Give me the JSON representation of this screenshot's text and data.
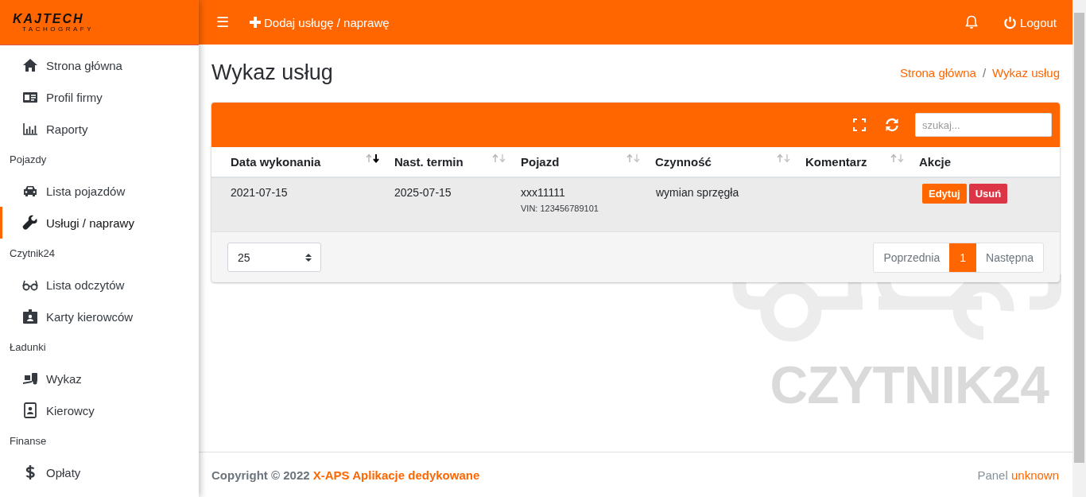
{
  "logo": {
    "name": "KAJTECH",
    "subtitle": "TACHOGRAFY"
  },
  "sidebar": {
    "sections": [
      {
        "items": [
          {
            "label": "Strona główna",
            "selected": false
          },
          {
            "label": "Profil firmy",
            "selected": false
          },
          {
            "label": "Raporty",
            "selected": false
          }
        ]
      },
      {
        "label": "Pojazdy",
        "items": [
          {
            "label": "Lista pojazdów",
            "selected": false
          },
          {
            "label": "Usługi / naprawy",
            "selected": true
          }
        ]
      },
      {
        "label": "Czytnik24",
        "items": [
          {
            "label": "Lista odczytów",
            "selected": false
          },
          {
            "label": "Karty kierowców",
            "selected": false
          }
        ]
      },
      {
        "label": "Ładunki",
        "items": [
          {
            "label": "Wykaz",
            "selected": false
          },
          {
            "label": "Kierowcy",
            "selected": false
          }
        ]
      },
      {
        "label": "Finanse",
        "items": [
          {
            "label": "Opłaty",
            "selected": false
          }
        ]
      }
    ]
  },
  "topbar": {
    "menu_icon": "☰",
    "add_button": "Dodaj usługę / naprawę",
    "logout": "Logout"
  },
  "page": {
    "title": "Wykaz usług",
    "breadcrumb": [
      "Strona główna",
      "Wykaz usług"
    ],
    "breadcrumb_separator": "/"
  },
  "card": {
    "search": {
      "placeholder": "szukaj..."
    },
    "table": {
      "columns": [
        {
          "label": "Data wykonania",
          "sortable": true,
          "sorted": true
        },
        {
          "label": "Nast. termin",
          "sortable": true,
          "sorted": false
        },
        {
          "label": "Pojazd",
          "sortable": true,
          "sorted": false
        },
        {
          "label": "Czynność",
          "sortable": true,
          "sorted": false
        },
        {
          "label": "Komentarz",
          "sortable": true,
          "sorted": false
        },
        {
          "label": "Akcje"
        }
      ],
      "rows": [
        {
          "date": "2021-07-15",
          "next": "2025-07-15",
          "vehicle": "xxx11111",
          "vin": "VIN: 123456789101",
          "activity": "wymian sprzęgła",
          "comment": "",
          "actions": [
            "Edytuj",
            "Usuń"
          ]
        }
      ]
    },
    "page_size": "25",
    "pagination": {
      "prev": "Poprzednia",
      "pages": [
        {
          "label": "1",
          "selected": true
        }
      ],
      "next": "Następna"
    }
  },
  "background_logo": {
    "text": "CZYTNIK24"
  },
  "footer": {
    "copyright": "Copyright © 2022",
    "company": "X-APS Aplikacje dedykowane",
    "panel": "Panel",
    "version": "unknown"
  }
}
